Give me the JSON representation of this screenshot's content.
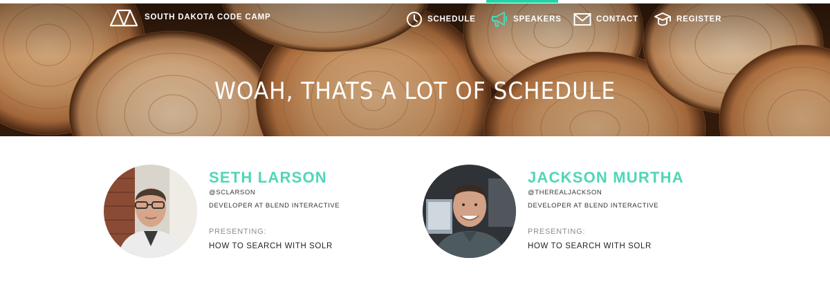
{
  "brand": {
    "name": "SOUTH DAKOTA CODE CAMP",
    "icon": "tent-icon"
  },
  "nav": {
    "items": [
      {
        "label": "SCHEDULE",
        "icon": "clock-icon"
      },
      {
        "label": "SPEAKERS",
        "icon": "megaphone-icon",
        "active": true
      },
      {
        "label": "CONTACT",
        "icon": "envelope-icon"
      },
      {
        "label": "REGISTER",
        "icon": "graduation-cap-icon"
      }
    ]
  },
  "hero": {
    "title": "WOAH, THATS A LOT OF SCHEDULE"
  },
  "speakers": [
    {
      "name": "SETH LARSON",
      "handle": "@SCLARSON",
      "role": "DEVELOPER AT BLEND INTERACTIVE",
      "presenting_label": "PRESENTING:",
      "talk": "HOW TO SEARCH WITH SOLR"
    },
    {
      "name": "JACKSON MURTHA",
      "handle": "@THEREALJACKSON",
      "role": "DEVELOPER AT BLEND INTERACTIVE",
      "presenting_label": "PRESENTING:",
      "talk": "HOW TO SEARCH WITH SOLR"
    }
  ],
  "colors": {
    "accent": "#4fd6b7",
    "active_bar": "#22d3a6"
  }
}
